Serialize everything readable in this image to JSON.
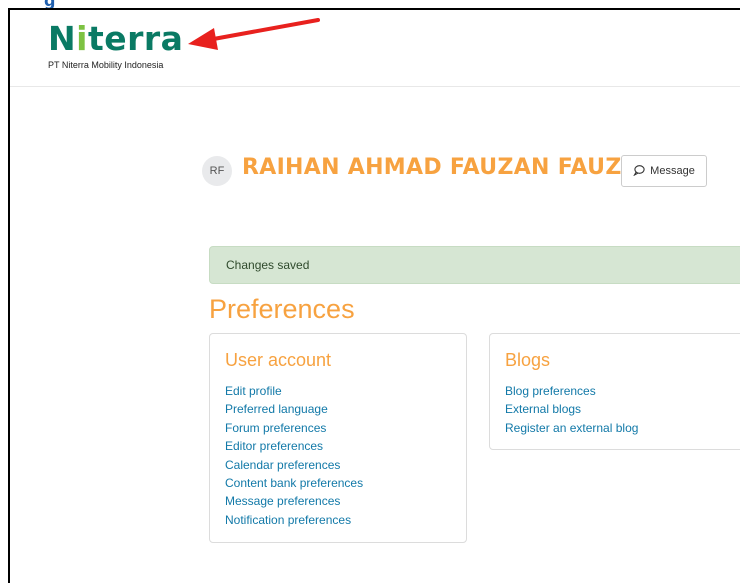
{
  "header": {
    "logo_text_prefix": "N",
    "logo_text_dot": "i",
    "logo_text_suffix": "terra",
    "logo_subtitle": "PT Niterra Mobility Indonesia",
    "top_cut_glyph": "g"
  },
  "profile": {
    "initials": "RF",
    "full_name": "RAIHAN AHMAD FAUZAN FAUZAN",
    "message_button": "Message",
    "message_icon": "speech-bubble-icon"
  },
  "alert": {
    "text": "Changes saved"
  },
  "preferences": {
    "title": "Preferences",
    "user_account": {
      "heading": "User account",
      "links": [
        "Edit profile",
        "Preferred language",
        "Forum preferences",
        "Editor preferences",
        "Calendar preferences",
        "Content bank preferences",
        "Message preferences",
        "Notification preferences"
      ]
    },
    "blogs": {
      "heading": "Blogs",
      "links": [
        "Blog preferences",
        "External blogs",
        "Register an external blog"
      ]
    }
  },
  "colors": {
    "accent_orange": "#f7a240",
    "link_blue": "#1279a8",
    "logo_teal": "#0a7a64",
    "logo_green": "#7dc242",
    "alert_bg": "#d6e6d3",
    "annotation_red": "#e8211e"
  }
}
